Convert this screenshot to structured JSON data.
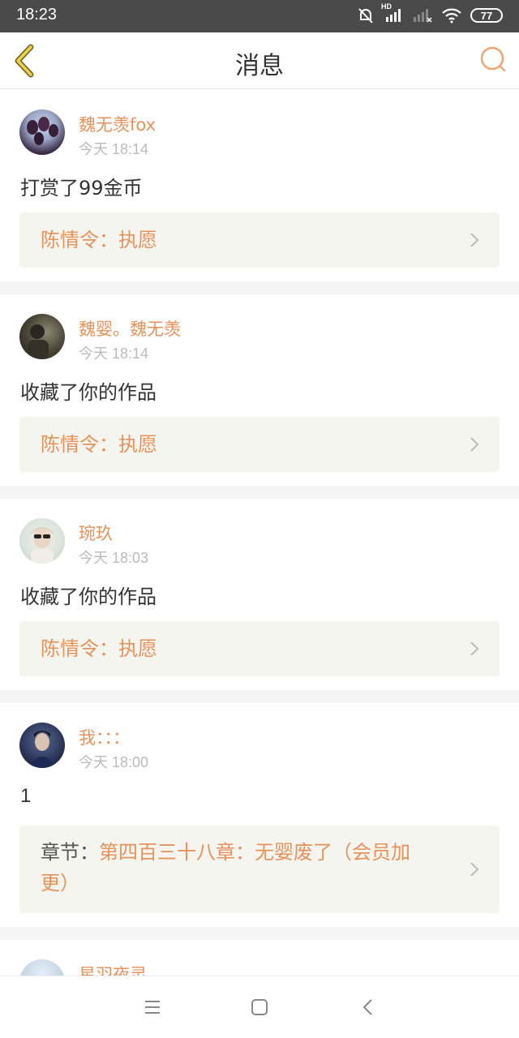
{
  "status_bar": {
    "time": "18:23",
    "battery": "77",
    "network_badge": "HD"
  },
  "header": {
    "title": "消息"
  },
  "messages": [
    {
      "username": "魏无羡fox",
      "time": "今天 18:14",
      "action": "打赏了99金币",
      "ref_prefix": "",
      "ref_text": "陈情令：执愿"
    },
    {
      "username": "魏婴。魏无羡",
      "time": "今天 18:14",
      "action": "收藏了你的作品",
      "ref_prefix": "",
      "ref_text": "陈情令：执愿"
    },
    {
      "username": "琬玖",
      "time": "今天 18:03",
      "action": "收藏了你的作品",
      "ref_prefix": "",
      "ref_text": "陈情令：执愿"
    },
    {
      "username": "我：：：",
      "time": "今天 18:00",
      "action": "1",
      "ref_prefix": "章节：",
      "ref_text": "第四百三十八章：无婴废了（会员加",
      "ref_text_line2": "更）"
    },
    {
      "username": "星羽夜灵"
    }
  ],
  "colors": {
    "accent": "#e8925a",
    "ref_bg": "#f5f5ef",
    "divider": "#f5f5f5"
  },
  "icons": {
    "back": "chevron-left-icon",
    "search": "search-icon",
    "chevron": "chevron-right-icon",
    "menu": "menu-icon",
    "home": "home-square-icon",
    "nav_back": "nav-back-icon"
  }
}
